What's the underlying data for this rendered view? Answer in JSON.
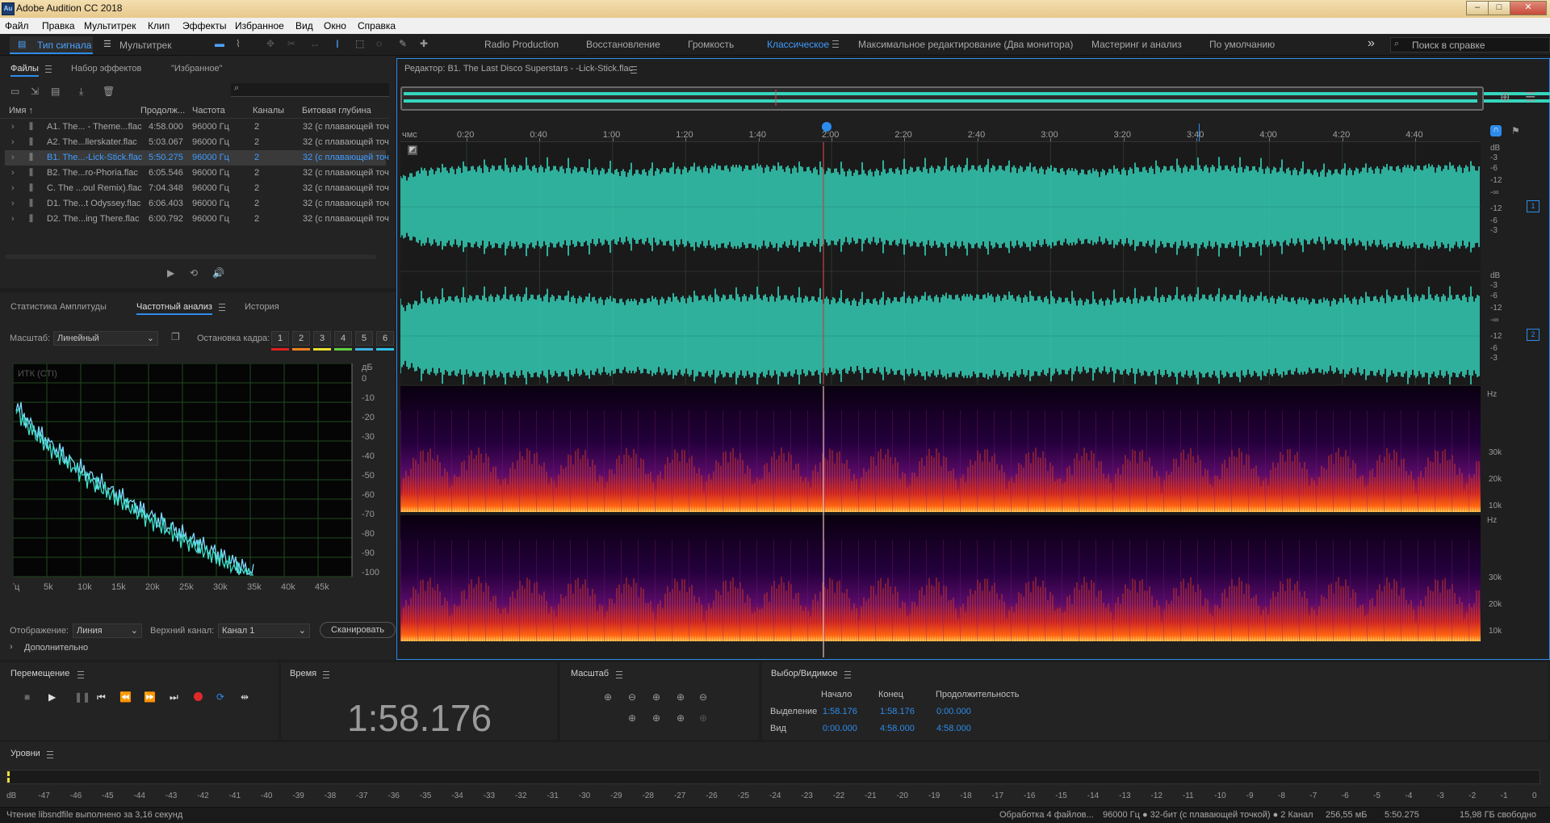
{
  "window": {
    "title": "Adobe Audition CC 2018",
    "app_icon": "Au"
  },
  "menu": [
    "Файл",
    "Правка",
    "Мультитрек",
    "Клип",
    "Эффекты",
    "Избранное",
    "Вид",
    "Окно",
    "Справка"
  ],
  "toolbar": {
    "waveform_tab": "Тип сигнала",
    "multitrack_tab": "Мультитрек",
    "workspaces": [
      "Radio Production",
      "Восстановление",
      "Громкость",
      "Классическое",
      "Максимальное редактирование (Два монитора)",
      "Мастеринг и анализ",
      "По умолчанию"
    ],
    "active_workspace": "Классическое",
    "search_placeholder": "Поиск в справке",
    "more": "»"
  },
  "files_panel": {
    "tabs": [
      "Файлы",
      "Набор эффектов",
      "\"Избранное\""
    ],
    "columns": [
      "Имя ↑",
      "Продолж...",
      "Частота",
      "Каналы",
      "Битовая глубина"
    ],
    "search_icon": "⌕",
    "files": [
      {
        "name": "A1. The... - Theme...flac",
        "duration": "4:58.000",
        "rate": "96000 Гц",
        "channels": "2",
        "depth": "32 (с плавающей точ"
      },
      {
        "name": "A2. The...llerskater.flac",
        "duration": "5:03.067",
        "rate": "96000 Гц",
        "channels": "2",
        "depth": "32 (с плавающей точ"
      },
      {
        "name": "B1. The...-Lick-Stick.flac",
        "duration": "5:50.275",
        "rate": "96000 Гц",
        "channels": "2",
        "depth": "32 (с плавающей точ"
      },
      {
        "name": "B2. The...ro-Phoria.flac",
        "duration": "6:05.546",
        "rate": "96000 Гц",
        "channels": "2",
        "depth": "32 (с плавающей точ"
      },
      {
        "name": "C. The ...oul Remix).flac",
        "duration": "7:04.348",
        "rate": "96000 Гц",
        "channels": "2",
        "depth": "32 (с плавающей точ"
      },
      {
        "name": "D1. The...t Odyssey.flac",
        "duration": "6:06.403",
        "rate": "96000 Гц",
        "channels": "2",
        "depth": "32 (с плавающей точ"
      },
      {
        "name": "D2. The...ing There.flac",
        "duration": "6:00.792",
        "rate": "96000 Гц",
        "channels": "2",
        "depth": "32 (с плавающей точ"
      }
    ],
    "selected_index": 2
  },
  "analysis_panel": {
    "tabs": [
      "Статистика Амплитуды",
      "Частотный анализ",
      "История"
    ],
    "scale_label": "Масштаб:",
    "scale_value": "Линейный",
    "hold_label": "Остановка кадра:",
    "hold_buttons": [
      "1",
      "2",
      "3",
      "4",
      "5",
      "6"
    ],
    "hold_colors": [
      "#e02020",
      "#f08020",
      "#e8e030",
      "#60d040",
      "#40b0e0",
      "#30c0e8"
    ],
    "graph_label": "ИТК (СТI)",
    "db_unit": "дБ",
    "db_ticks": [
      "0",
      "-10",
      "-20",
      "-30",
      "-40",
      "-50",
      "-60",
      "-70",
      "-80",
      "-90",
      "-100"
    ],
    "freq_ticks": [
      "Гц",
      "5k",
      "10k",
      "15k",
      "20k",
      "25k",
      "30k",
      "35k",
      "40k",
      "45k"
    ],
    "display_label": "Отображение:",
    "display_value": "Линия",
    "upper_label": "Верхний канал:",
    "upper_value": "Канал 1",
    "scan_button": "Сканировать",
    "more_label": "Дополнительно"
  },
  "editor": {
    "title": "Редактор: B1. The Last Disco Superstars - -Lick-Stick.flac",
    "ruler": [
      "чмс",
      "0:20",
      "0:40",
      "1:00",
      "1:20",
      "1:40",
      "2:00",
      "2:20",
      "2:40",
      "3:00",
      "3:20",
      "3:40",
      "4:00",
      "4:20",
      "4:40"
    ],
    "db_labels": [
      "dB",
      "-3",
      "-6",
      "-12",
      "-∞",
      "-12",
      "-6",
      "-3"
    ],
    "channel_badges": [
      "1",
      "2"
    ],
    "hz_label": "Hz",
    "hz_ticks": [
      "30k",
      "20k",
      "10k"
    ],
    "playhead_fraction": 0.395,
    "wave_color": "#35d6be"
  },
  "transport": {
    "title": "Перемещение"
  },
  "time_panel": {
    "title": "Время",
    "value": "1:58.176"
  },
  "zoom_panel": {
    "title": "Масштаб"
  },
  "selection_panel": {
    "title": "Выбор/Видимое",
    "headers": [
      "Начало",
      "Конец",
      "Продолжительность"
    ],
    "rows": [
      {
        "label": "Выделение",
        "start": "1:58.176",
        "end": "1:58.176",
        "duration": "0:00.000"
      },
      {
        "label": "Вид",
        "start": "0:00.000",
        "end": "4:58.000",
        "duration": "4:58.000"
      }
    ]
  },
  "levels": {
    "title": "Уровни",
    "scale": [
      "dB",
      "-47",
      "-46",
      "-45",
      "-44",
      "-43",
      "-42",
      "-41",
      "-40",
      "-39",
      "-38",
      "-37",
      "-36",
      "-35",
      "-34",
      "-33",
      "-32",
      "-31",
      "-30",
      "-29",
      "-28",
      "-27",
      "-26",
      "-25",
      "-24",
      "-23",
      "-22",
      "-21",
      "-20",
      "-19",
      "-18",
      "-17",
      "-16",
      "-15",
      "-14",
      "-13",
      "-12",
      "-11",
      "-10",
      "-9",
      "-8",
      "-7",
      "-6",
      "-5",
      "-4",
      "-3",
      "-2",
      "-1",
      "0"
    ]
  },
  "status": {
    "left": "Чтение libsndfile выполнено за 3,16 секунд",
    "processing": "Обработка 4 файлов...",
    "format": "96000 Гц ● 32-бит (с плавающей точкой) ● 2 Канал",
    "size": "256,55 мБ",
    "duration": "5:50.275",
    "free": "15,98 ГБ свободно"
  }
}
